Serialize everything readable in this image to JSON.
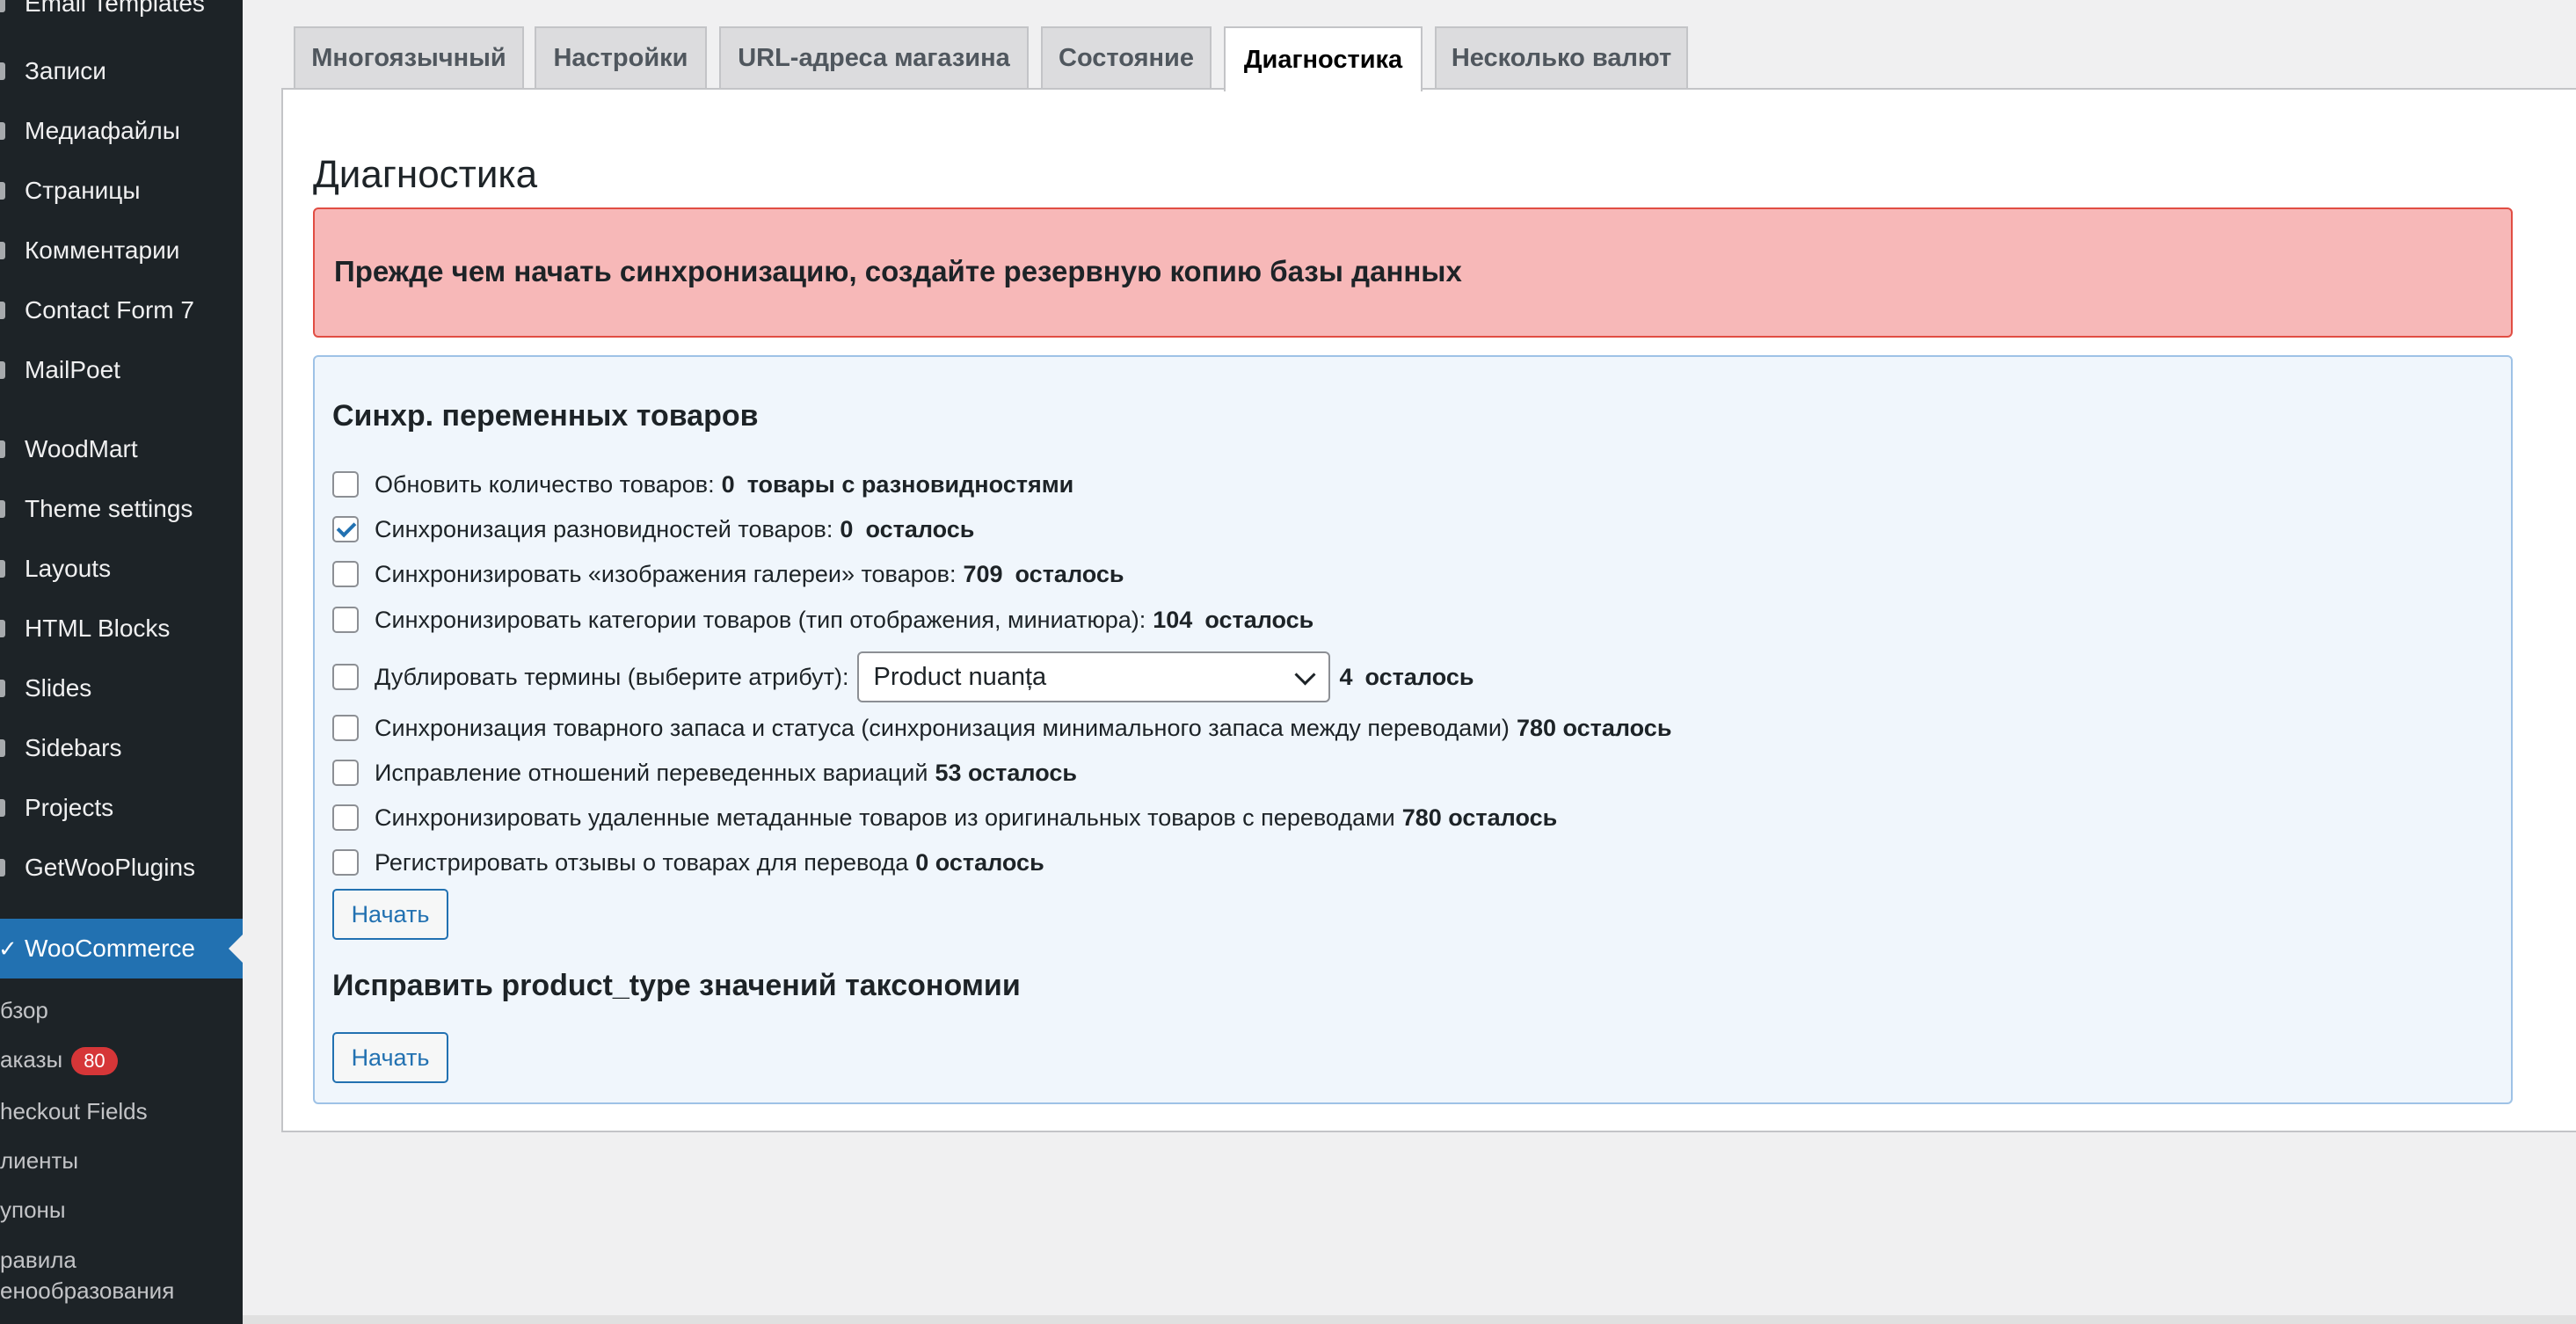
{
  "sidebar": {
    "top_partial": "Email Templates",
    "items": [
      {
        "label": "Записи"
      },
      {
        "label": "Медиафайлы"
      },
      {
        "label": "Страницы"
      },
      {
        "label": "Комментарии"
      },
      {
        "label": "Contact Form 7"
      },
      {
        "label": "MailPoet"
      },
      {
        "label": "WoodMart"
      },
      {
        "label": "Theme settings"
      },
      {
        "label": "Layouts"
      },
      {
        "label": "HTML Blocks"
      },
      {
        "label": "Slides"
      },
      {
        "label": "Sidebars"
      },
      {
        "label": "Projects"
      },
      {
        "label": "GetWooPlugins"
      },
      {
        "label": "WooCommerce"
      }
    ],
    "submenu": [
      {
        "label": "бзор"
      },
      {
        "label": "аказы",
        "badge": "80"
      },
      {
        "label": "heckout Fields"
      },
      {
        "label": "лиенты"
      },
      {
        "label": "упоны"
      },
      {
        "label": "равила"
      },
      {
        "label": "енообразования"
      }
    ]
  },
  "tabs": [
    {
      "label": "Многоязычный"
    },
    {
      "label": "Настройки"
    },
    {
      "label": "URL-адреса магазина"
    },
    {
      "label": "Состояние"
    },
    {
      "label": "Диагностика"
    },
    {
      "label": "Несколько валют"
    }
  ],
  "page": {
    "title": "Диагностика",
    "alert": "Прежде чем начать синхронизацию, создайте резервную копию базы данных",
    "section1_title": "Синхр. переменных товаров",
    "section2_title": "Исправить product_type значений таксономии",
    "start_label": "Начать",
    "options": [
      {
        "label": "Обновить количество товаров:",
        "value": "0",
        "suffix": "товары с разновидностями",
        "checked": false
      },
      {
        "label": "Синхронизация разновидностей товаров:",
        "value": "0",
        "suffix": "осталось",
        "checked": true
      },
      {
        "label": "Синхронизировать «изображения галереи» товаров:",
        "value": "709",
        "suffix": "осталось",
        "checked": false
      },
      {
        "label": "Синхронизировать категории товаров (тип отображения, миниатюра):",
        "value": "104",
        "suffix": "осталось",
        "checked": false
      },
      {
        "label": "Дублировать термины (выберите атрибут):",
        "select_value": "Product nuanța",
        "value": "4",
        "suffix": "осталось",
        "checked": false
      },
      {
        "label": "Синхронизация товарного запаса и статуса (синхронизация минимального запаса между переводами)",
        "value": "780 осталось",
        "checked": false
      },
      {
        "label": "Исправление отношений переведенных вариаций",
        "value": "53 осталось",
        "checked": false
      },
      {
        "label": "Синхронизировать удаленные метаданные товаров из оригинальных товаров с переводами",
        "value": "780 осталось",
        "checked": false
      },
      {
        "label": "Регистрировать отзывы о товарах для перевода",
        "value": "0 осталось",
        "checked": false
      }
    ]
  }
}
